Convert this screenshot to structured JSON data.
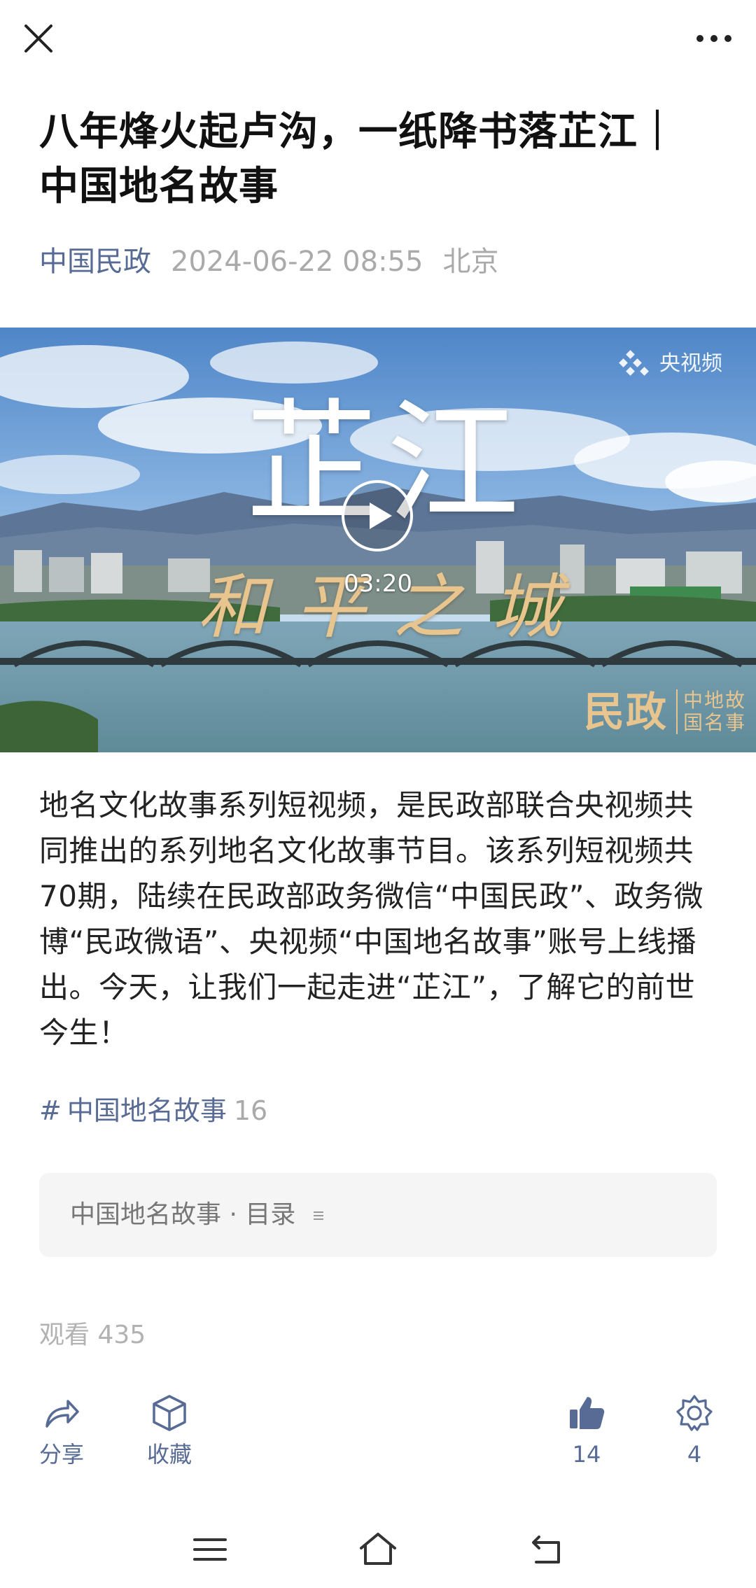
{
  "header": {
    "close_icon": "close-icon",
    "more_icon": "more-dots-icon"
  },
  "article": {
    "title": "八年烽火起卢沟，一纸降书落芷江｜中国地名故事",
    "author": "中国民政",
    "date": "2024-06-22 08:55",
    "location": "北京",
    "body": "地名文化故事系列短视频，是民政部联合央视频共同推出的系列地名文化故事节目。该系列短视频共70期，陆续在民政部政务微信“中国民政”、政务微博“民政微语”、央视频“中国地名故事”账号上线播出。今天，让我们一起走进“芷江”，了解它的前世今生！"
  },
  "video": {
    "overlay_title": "芷江",
    "overlay_subtitle": "和平之城",
    "duration": "03:20",
    "source_brand": "央视频",
    "corner_logo_main": "民政",
    "corner_logo_sub": "中地故国名事",
    "play_icon": "play-icon"
  },
  "tag": {
    "hash": "#",
    "name": "中国地名故事",
    "count": "16"
  },
  "collection": {
    "label": "中国地名故事 · 目录"
  },
  "stats": {
    "views": "观看 435"
  },
  "actions": {
    "share_label": "分享",
    "favorite_label": "收藏",
    "like_count": "14",
    "wow_count": "4"
  },
  "colors": {
    "link": "#576b95",
    "muted": "#aaaaaa",
    "text": "#222222",
    "gold": "#e8c48e"
  },
  "system_nav": {
    "menu_icon": "menu-icon",
    "home_icon": "home-icon",
    "back_icon": "back-icon"
  }
}
